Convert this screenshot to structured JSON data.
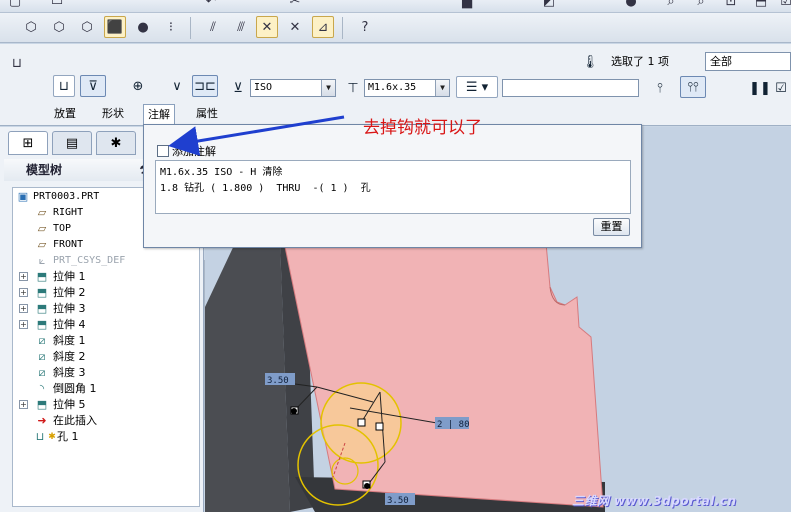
{
  "dashboard": {
    "thread_standard": "ISO",
    "screw_size": "M1.6x.35",
    "depth_value": "",
    "selection_status": "选取了 1 项",
    "filter_value": "全部",
    "tabs": [
      {
        "label": "放置"
      },
      {
        "label": "形状"
      },
      {
        "label": "注解"
      },
      {
        "label": "属性"
      }
    ]
  },
  "model_tree": {
    "title": "模型树",
    "nodes": [
      {
        "label": "PRT0003.PRT",
        "icon": "part-icon"
      },
      {
        "label": "RIGHT",
        "icon": "datum-plane-icon"
      },
      {
        "label": "TOP",
        "icon": "datum-plane-icon"
      },
      {
        "label": "FRONT",
        "icon": "datum-plane-icon"
      },
      {
        "label": "PRT_CSYS_DEF",
        "icon": "csys-icon"
      },
      {
        "label": "拉伸 1",
        "icon": "extrude-icon"
      },
      {
        "label": "拉伸 2",
        "icon": "extrude-icon"
      },
      {
        "label": "拉伸 3",
        "icon": "extrude-icon"
      },
      {
        "label": "拉伸 4",
        "icon": "extrude-icon"
      },
      {
        "label": "斜度 1",
        "icon": "draft-icon"
      },
      {
        "label": "斜度 2",
        "icon": "draft-icon"
      },
      {
        "label": "斜度 3",
        "icon": "draft-icon"
      },
      {
        "label": "倒圆角 1",
        "icon": "round-icon"
      },
      {
        "label": "拉伸 5",
        "icon": "extrude-icon"
      },
      {
        "label": "在此插入",
        "icon": "insert-here-arrow-icon"
      },
      {
        "label": "孔 1",
        "icon": "hole-icon"
      }
    ]
  },
  "note_panel": {
    "checkbox_label": "添加注解",
    "checked": false,
    "note_lines": [
      "M1.6x.35 ISO - H 清除",
      "1.8 钻孔 ( 1.800 )  THRU  -( 1 )  孔"
    ],
    "reset_label": "重置"
  },
  "annotation": {
    "hint_text": "去掉钩就可以了",
    "arrow_color": "#1f3fcf",
    "hint_color": "#d91616"
  },
  "model_view": {
    "dims": [
      "3.50",
      "2 | 80",
      "3.50"
    ],
    "part_color": "#f1b3b5",
    "dark_face_color": "#4b4d52"
  },
  "watermark": "三维网 www.3dportal.cn"
}
